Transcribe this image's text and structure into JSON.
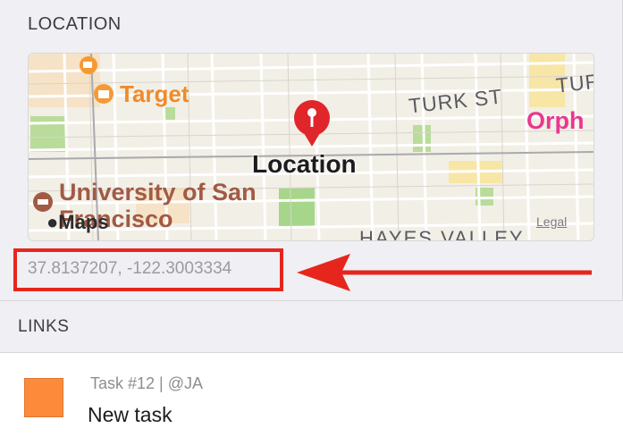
{
  "location": {
    "section_title": "LOCATION",
    "map": {
      "labels": {
        "target": "Target",
        "turk_st": "TURK ST",
        "turk_partial": "TUR",
        "orph": "Orph",
        "pin": "Location",
        "university": "University of San Francisco",
        "maps": "Maps",
        "legal": "Legal",
        "hayes": "HAYES VALLEY"
      },
      "pin_color": "#e0262b",
      "icons": [
        "shopping-cart-icon",
        "shopping-bag-icon",
        "university-icon",
        "apple-logo-icon",
        "map-pin-icon"
      ]
    },
    "coordinates": "37.8137207, -122.3003334",
    "highlight_color": "#e6261c"
  },
  "links": {
    "section_title": "LINKS",
    "items": [
      {
        "meta": "Task #12 | @JA",
        "title": "New task",
        "color": "#fd8a3b"
      }
    ]
  }
}
